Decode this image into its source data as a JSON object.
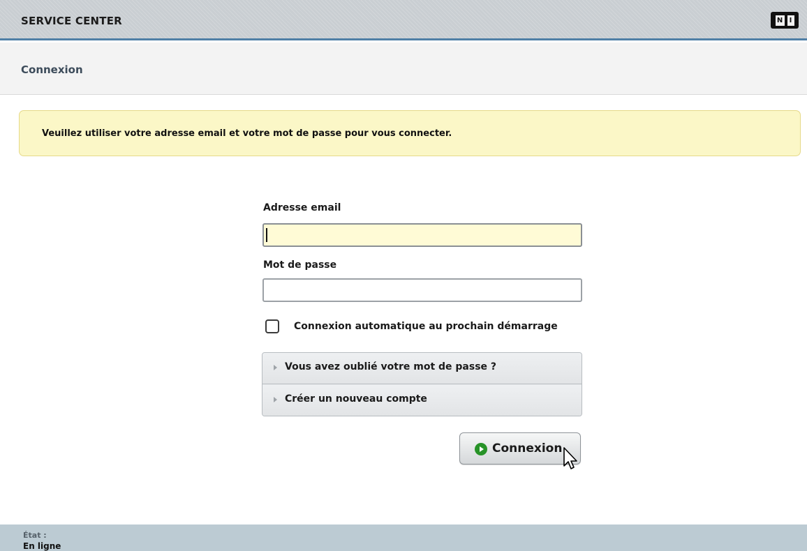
{
  "app": {
    "title": "SERVICE CENTER",
    "logo_text": "NI"
  },
  "section": {
    "title": "Connexion"
  },
  "notice": {
    "text": "Veuillez utiliser votre adresse email et votre mot de passe pour vous connecter."
  },
  "form": {
    "email_label": "Adresse email",
    "email_value": "",
    "password_label": "Mot de passe",
    "password_value": "",
    "autologin_label": "Connexion automatique au prochain démarrage",
    "autologin_checked": false
  },
  "links": [
    {
      "label": "Vous avez oublié votre mot de passe ?"
    },
    {
      "label": "Créer un nouveau compte"
    }
  ],
  "login_button": {
    "label": "Connexion",
    "icon": "play-circle-icon"
  },
  "status": {
    "label": "État :",
    "value": "En ligne"
  },
  "colors": {
    "accent_line": "#4f7fa6",
    "notice_bg": "#fbf7c7",
    "button_icon": "#279327",
    "statusbar_bg": "#bccbd3"
  }
}
